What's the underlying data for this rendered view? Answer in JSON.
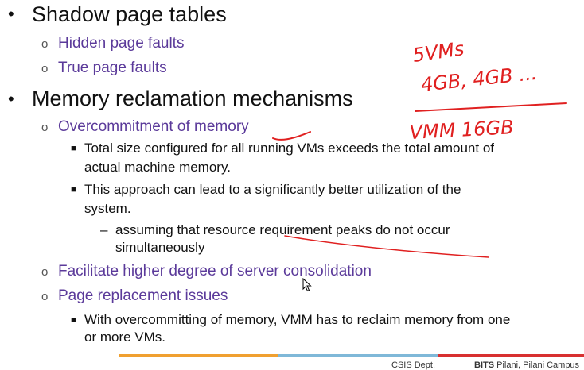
{
  "bullets": {
    "level1": "•",
    "level2": "o",
    "level3": "■",
    "level4": "–"
  },
  "items": {
    "shadow_page_tables": "Shadow page tables",
    "hidden_page_faults": "Hidden page faults",
    "true_page_faults": "True page faults",
    "memory_reclamation": "Memory reclamation mechanisms",
    "overcommitment": "Overcommitment of memory",
    "total_size_line1": "Total size configured for all running VMs exceeds the total amount of",
    "total_size_line2": "actual machine memory.",
    "approach_line1": "This approach can lead to a significantly  better  utilization  of  the",
    "approach_line2": "system.",
    "assuming_line1": "assuming   that resource requirement peaks do not occur",
    "assuming_line2": "simultaneously",
    "facilitate": "Facilitate higher degree of  server consolidation",
    "page_replacement": "Page replacement issues",
    "overcommitting_line1": "With overcommitting of memory, VMM has to reclaim memory from one",
    "overcommitting_line2": "or more VMs."
  },
  "handwriting": {
    "line1": "5VMs",
    "line2": "4GB, 4GB ...",
    "line3": "VMM  16GB"
  },
  "footer": {
    "dept": "CSIS Dept.",
    "campus_bold": "BITS",
    "campus_rest": " Pilani, Pilani Campus"
  },
  "colors": {
    "purple_text": "#5b3a9a",
    "ink_red": "#e02020",
    "footer_orange": "#f0a030",
    "footer_blue": "#7fb8d8",
    "footer_red": "#d83030"
  }
}
